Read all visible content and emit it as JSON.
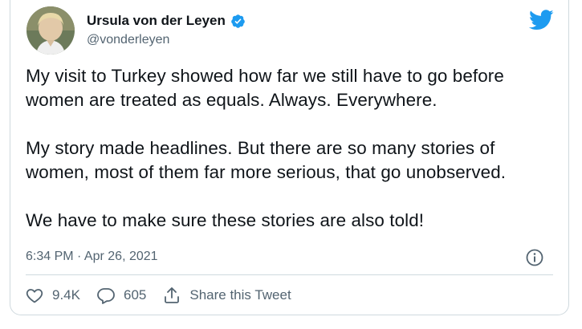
{
  "user": {
    "name": "Ursula von der Leyen",
    "handle": "@vonderleyen",
    "verified": true
  },
  "tweet": {
    "paragraphs": [
      "My visit to Turkey showed how far we still have to go before women are treated as equals. Always. Everywhere.",
      "My story made headlines. But there are so many stories of women, most of them far more serious, that go unobserved.",
      "We have to make sure these stories are also told!"
    ],
    "timestamp": "6:34 PM · Apr 26, 2021"
  },
  "actions": {
    "likes": "9.4K",
    "replies": "605",
    "share_label": "Share this Tweet"
  },
  "icons": [
    "twitter-bird-icon",
    "verified-badge-icon",
    "info-icon",
    "heart-icon",
    "reply-icon",
    "share-icon"
  ],
  "colors": {
    "twitter_blue": "#1d9bf0",
    "text": "#0f1419",
    "muted": "#536471",
    "border": "#cfd9de"
  }
}
